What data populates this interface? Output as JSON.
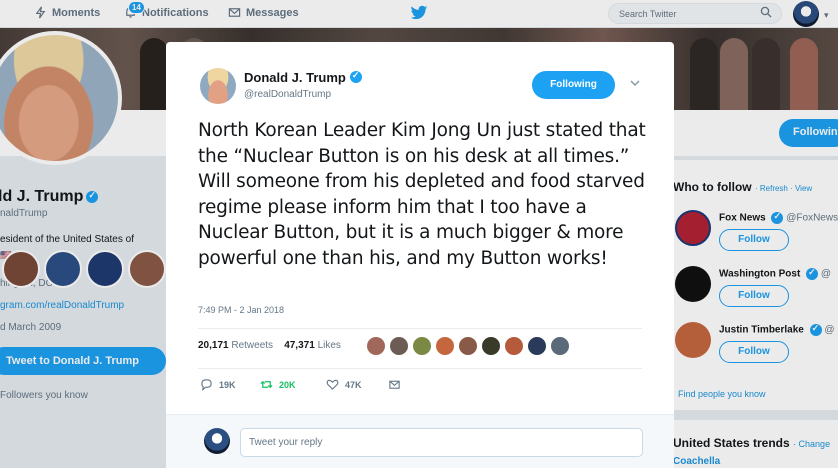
{
  "nav": {
    "moments": "Moments",
    "notifications": "Notifications",
    "notifications_badge": "14",
    "messages": "Messages",
    "search_placeholder": "Search Twitter",
    "accent": "#1da1f2"
  },
  "profile": {
    "follow_button": "Following",
    "name": "ld J. Trump",
    "handle": "naldTrump",
    "bio": "esident of the United States of",
    "location": "hington, DC",
    "link": "gram.com/realDonaldTrump",
    "joined": "d March 2009",
    "tweet_to": "Tweet to Donald J. Trump",
    "followers_you_know": "Followers you know"
  },
  "sidebar": {
    "who_to_follow": "Who to follow",
    "refresh": "· Refresh · View",
    "suggestions": [
      {
        "name": "Fox News",
        "handle": "@FoxNews",
        "button": "Follow"
      },
      {
        "name": "Washington Post",
        "handle": "@",
        "button": "Follow"
      },
      {
        "name": "Justin Timberlake",
        "handle": "@",
        "button": "Follow"
      }
    ],
    "find_people": "Find people you know",
    "trends_title": "United States trends",
    "trends_change": "· Change",
    "trend_1": "Coachella"
  },
  "tweet": {
    "author_name": "Donald J. Trump",
    "author_handle": "@realDonaldTrump",
    "following_button": "Following",
    "text": "North Korean Leader Kim Jong Un just stated that the “Nuclear Button is on his desk at all times.” Will someone from his depleted and food starved regime please inform him that I too have a Nuclear Button, but it is a much bigger & more powerful one than his, and my Button works!",
    "timestamp": "7:49 PM - 2 Jan 2018",
    "retweets_count": "20,171",
    "retweets_label": "Retweets",
    "likes_count": "47,371",
    "likes_label": "Likes",
    "reply_count": "19K",
    "retweet_action_count": "20K",
    "like_action_count": "47K",
    "reply_placeholder": "Tweet your reply",
    "retweet_color": "#17bf63"
  }
}
